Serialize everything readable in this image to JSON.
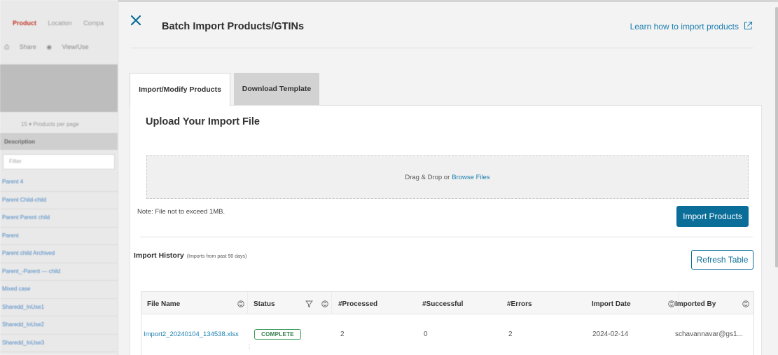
{
  "background": {
    "tabs": [
      "Product",
      "Location",
      "Compa"
    ],
    "actions": [
      {
        "icon": "share-icon",
        "label": "Share"
      },
      {
        "icon": "eye-icon",
        "label": "View/Use"
      }
    ],
    "per_page": "15  ▾  Products per page",
    "column_header": "Description",
    "filter_placeholder": "Filter",
    "rows": [
      "Parent 4",
      "Parent Child-child",
      "Parent Parent child",
      "Parent",
      "Parent child Archived",
      "Parent_-Parent --- child",
      "Mixed case",
      "Sharedd_InUse1",
      "Sharedd_InUse2",
      "Sharedd_InUse3"
    ]
  },
  "drawer": {
    "title": "Batch Import Products/GTINs",
    "learn_link": "Learn how to import products",
    "tabs": [
      {
        "label": "Import/Modify Products",
        "active": true
      },
      {
        "label": "Download Template",
        "active": false
      }
    ],
    "upload": {
      "title": "Upload Your Import File",
      "drop_text": "Drag & Drop or",
      "browse_link": "Browse Files",
      "note": "Note: File not to exceed 1MB.",
      "import_button": "Import Products"
    },
    "history": {
      "title": "Import History",
      "subtitle": "(Imports from past 90 days)",
      "refresh_button": "Refresh Table",
      "columns": [
        "File Name",
        "Status",
        "#Processed",
        "#Successful",
        "#Errors",
        "Import Date",
        "Imported By"
      ],
      "rows": [
        {
          "file_name": "Import2_20240104_134538.xlsx",
          "status": "COMPLETE",
          "processed": "2",
          "successful": "0",
          "errors": "2",
          "import_date": "2024-02-14",
          "imported_by": "schavannavar@gs1..."
        }
      ]
    }
  },
  "colors": {
    "accent": "#0b6e99",
    "link": "#1c7fb0",
    "status_complete": "#3a9a5b"
  }
}
